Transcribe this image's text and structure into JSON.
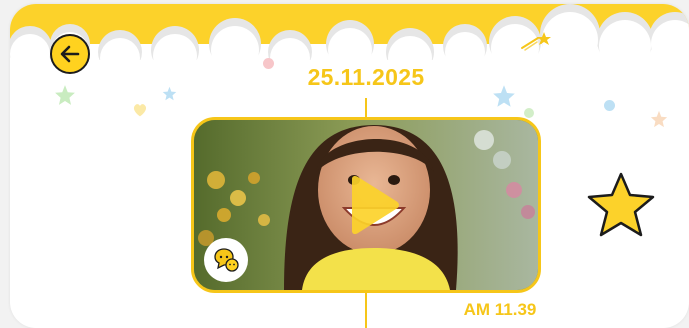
{
  "entry": {
    "date": "25.11.2025",
    "time": "AM 11.39"
  },
  "icons": {
    "back": "arrow-left-icon",
    "play": "play-icon",
    "mood": "chat-bubbles-icon",
    "favorite": "star-icon",
    "shooting_star": "shooting-star-icon"
  },
  "colors": {
    "accent": "#f6c619",
    "accent_light": "#ffd21f",
    "outline": "#1c1c1c",
    "background": "#ffffff"
  }
}
